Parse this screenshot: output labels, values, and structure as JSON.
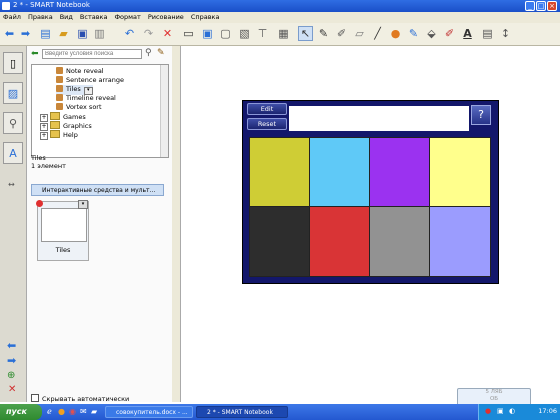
{
  "window": {
    "title": "2 * - SMART Notebook",
    "controls": [
      "_",
      "□",
      "×"
    ]
  },
  "menu": [
    "Файл",
    "Правка",
    "Вид",
    "Вставка",
    "Формат",
    "Рисование",
    "Справка"
  ],
  "side_panel": {
    "search_placeholder": "Введите условия поиска",
    "tree": [
      {
        "label": "Note reveal",
        "type": "item"
      },
      {
        "label": "Sentence arrange",
        "type": "item"
      },
      {
        "label": "Tiles",
        "type": "item",
        "selected": true
      },
      {
        "label": "Timeline reveal",
        "type": "item"
      },
      {
        "label": "Vortex sort",
        "type": "item"
      },
      {
        "label": "Games",
        "type": "folder"
      },
      {
        "label": "Graphics",
        "type": "folder"
      },
      {
        "label": "Help",
        "type": "folder"
      }
    ],
    "info_title": "Tiles",
    "info_count": "1 элемент",
    "category_label": "Интерактивные средства и мульт...",
    "thumbnail_label": "Tiles",
    "autohide_label": "Скрывать автоматически"
  },
  "widget": {
    "edit_label": "Edit",
    "reset_label": "Reset",
    "help_label": "?",
    "tiles": [
      {
        "color": "#cfcd35"
      },
      {
        "color": "#5fc9f7"
      },
      {
        "color": "#9b32f0"
      },
      {
        "color": "#ffff8c"
      },
      {
        "color": "#2d2d2d"
      },
      {
        "color": "#d93436"
      },
      {
        "color": "#929292"
      },
      {
        "color": "#9b9cfe"
      }
    ]
  },
  "taskbar": {
    "start_label": "пуск",
    "tasks": [
      "совокупитель.docx - ...",
      "2 * - SMART Notebook"
    ],
    "clock": "17:06"
  },
  "tooltip": {
    "line1": "5 ЛЯБ",
    "line2": "ОБ"
  }
}
